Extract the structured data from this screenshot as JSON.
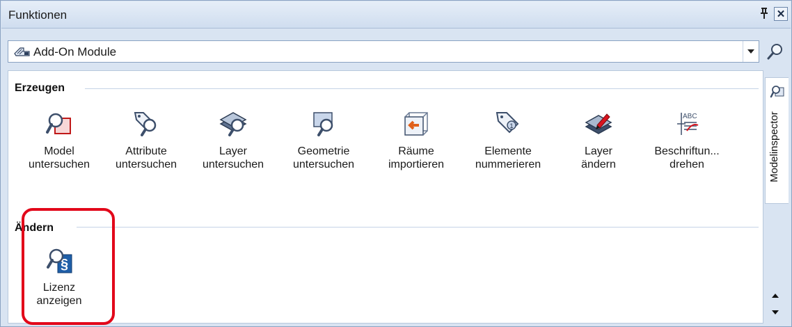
{
  "window": {
    "title": "Funktionen"
  },
  "titlebar": {
    "pin_glyph": "ᵖ",
    "close_glyph": "✕"
  },
  "combo": {
    "value": "Add-On Module",
    "icon": "addon-module-icon"
  },
  "sections": [
    {
      "label": "Erzeugen",
      "tools": [
        {
          "label": "Model\nuntersuchen",
          "icon": "model-inspect-icon"
        },
        {
          "label": "Attribute\nuntersuchen",
          "icon": "attribute-inspect-icon"
        },
        {
          "label": "Layer\nuntersuchen",
          "icon": "layer-inspect-icon"
        },
        {
          "label": "Geometrie\nuntersuchen",
          "icon": "geometry-inspect-icon"
        },
        {
          "label": "Räume\nimportieren",
          "icon": "rooms-import-icon"
        },
        {
          "label": "Elemente\nnummerieren",
          "icon": "elements-number-icon"
        },
        {
          "label": "Layer\nändern",
          "icon": "layer-edit-icon"
        },
        {
          "label": "Beschriftun...\ndrehen",
          "icon": "label-rotate-icon"
        }
      ]
    },
    {
      "label": "Ändern",
      "tools": [
        {
          "label": "Lizenz\nanzeigen",
          "icon": "license-show-icon"
        }
      ]
    }
  ],
  "side_tab": {
    "label": "Modelinspector",
    "icon": "modelinspector-icon"
  },
  "colors": {
    "highlight": "#e2081a",
    "accent": "#1f5fa8",
    "frame": "#d9e4f2"
  }
}
